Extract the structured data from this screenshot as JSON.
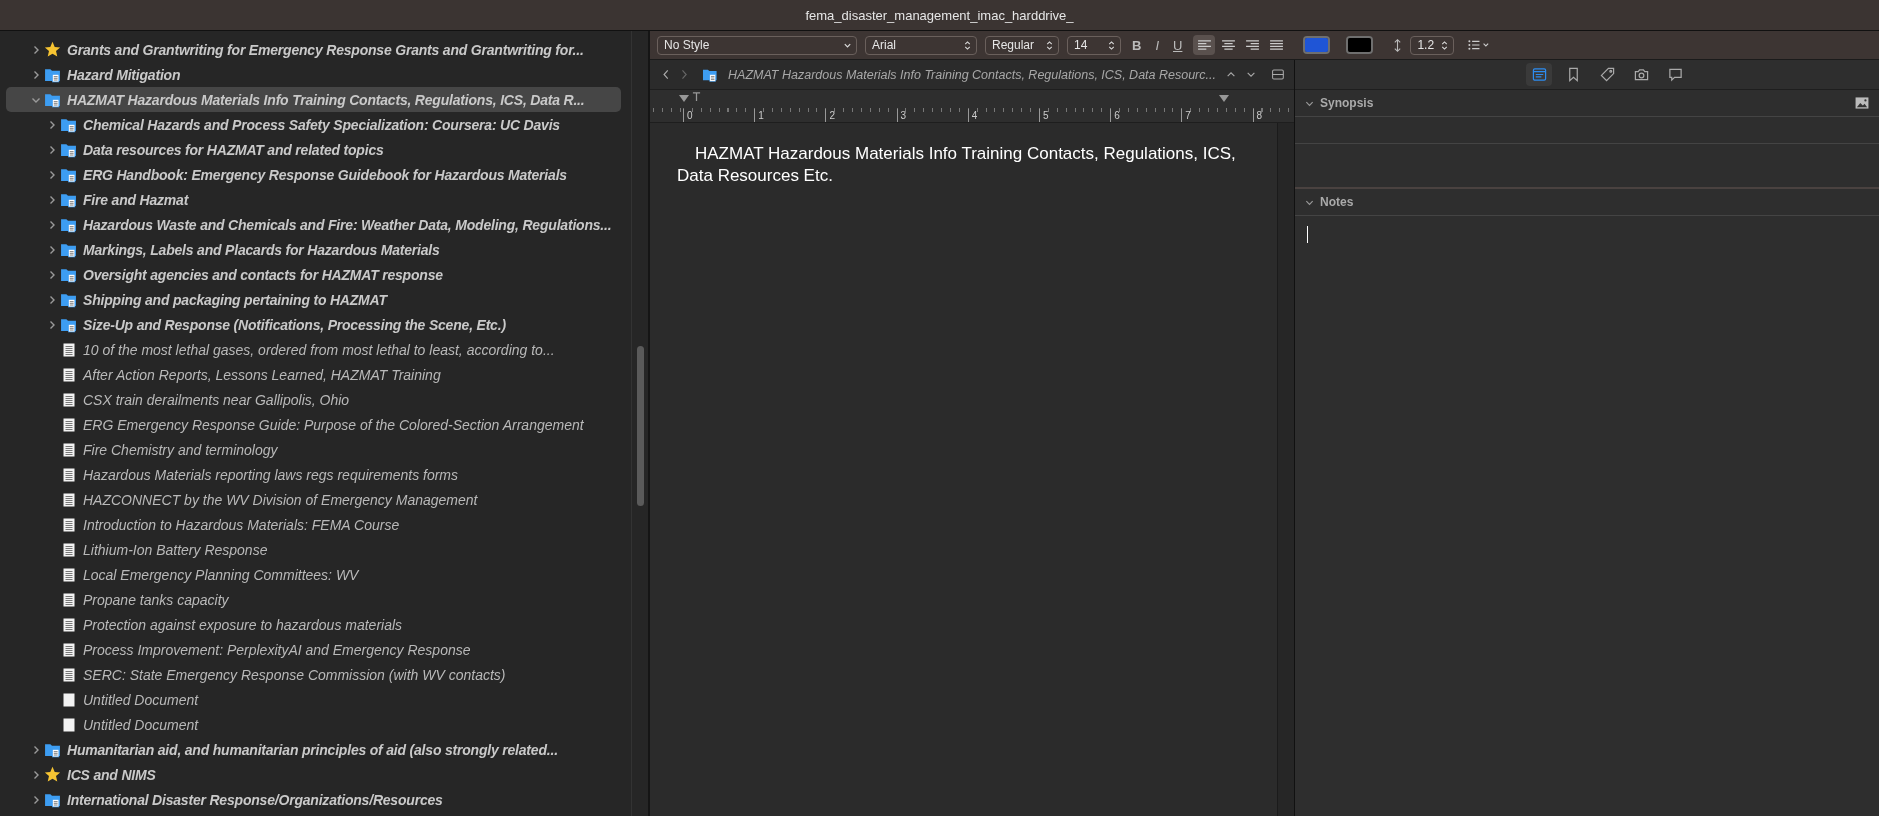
{
  "window": {
    "title": "fema_disaster_management_imac_harddrive_"
  },
  "binder": [
    {
      "kind": "star",
      "label": "Grants and Grantwriting for Emergency Response Grants and Grantwriting for...",
      "expanded": false,
      "selected": false
    },
    {
      "kind": "folder",
      "label": "Hazard Mitigation",
      "expanded": false,
      "selected": false
    },
    {
      "kind": "folder",
      "label": "HAZMAT Hazardous Materials Info Training Contacts, Regulations, ICS, Data R...",
      "expanded": true,
      "selected": true,
      "children": [
        {
          "kind": "folder",
          "label": "Chemical Hazards and Process Safety Specialization: Coursera: UC Davis",
          "expanded": false,
          "selected": false
        },
        {
          "kind": "folder",
          "label": "Data resources for HAZMAT and related topics",
          "expanded": false,
          "selected": false
        },
        {
          "kind": "folder",
          "label": "ERG Handbook: Emergency Response Guidebook for Hazardous Materials",
          "expanded": false,
          "selected": false
        },
        {
          "kind": "folder",
          "label": "Fire and Hazmat",
          "expanded": false,
          "selected": false
        },
        {
          "kind": "folder",
          "label": "Hazardous Waste and Chemicals and Fire: Weather Data, Modeling, Regulations...",
          "expanded": false,
          "selected": false
        },
        {
          "kind": "folder",
          "label": "Markings, Labels and Placards for Hazardous Materials",
          "expanded": false,
          "selected": false
        },
        {
          "kind": "folder",
          "label": "Oversight agencies and contacts for HAZMAT response",
          "expanded": false,
          "selected": false
        },
        {
          "kind": "folder",
          "label": "Shipping and packaging pertaining to HAZMAT",
          "expanded": false,
          "selected": false
        },
        {
          "kind": "folder",
          "label": "Size-Up and Response (Notifications, Processing the Scene, Etc.)",
          "expanded": false,
          "selected": false
        },
        {
          "kind": "doc",
          "label": "10 of the most lethal gases, ordered from most lethal to least, according to...",
          "selected": false
        },
        {
          "kind": "doc",
          "label": "After Action Reports, Lessons Learned, HAZMAT Training",
          "selected": false
        },
        {
          "kind": "doc",
          "label": "CSX train derailments near Gallipolis, Ohio",
          "selected": false
        },
        {
          "kind": "doc",
          "label": "ERG Emergency Response Guide: Purpose of the Colored-Section Arrangement",
          "selected": false
        },
        {
          "kind": "doc",
          "label": "Fire Chemistry and terminology",
          "selected": false
        },
        {
          "kind": "doc",
          "label": "Hazardous Materials reporting laws regs requirements forms",
          "selected": false
        },
        {
          "kind": "doc",
          "label": "HAZCONNECT by the WV Division of Emergency Management",
          "selected": false
        },
        {
          "kind": "doc",
          "label": "Introduction to Hazardous Materials: FEMA Course",
          "selected": false
        },
        {
          "kind": "doc",
          "label": "Lithium-Ion Battery Response",
          "selected": false
        },
        {
          "kind": "doc",
          "label": "Local Emergency Planning Committees: WV",
          "selected": false
        },
        {
          "kind": "doc",
          "label": "Propane tanks capacity",
          "selected": false
        },
        {
          "kind": "doc",
          "label": "Protection against exposure to hazardous materials",
          "selected": false
        },
        {
          "kind": "doc",
          "label": "Process Improvement: PerplexityAI and Emergency Response",
          "selected": false
        },
        {
          "kind": "doc",
          "label": "SERC: State Emergency Response Commission (with WV contacts)",
          "selected": false
        },
        {
          "kind": "blank",
          "label": "Untitled Document",
          "selected": false
        },
        {
          "kind": "blank",
          "label": "Untitled Document",
          "selected": false
        }
      ]
    },
    {
      "kind": "folder",
      "label": "Humanitarian aid, and humanitarian principles of aid (also strongly related...",
      "expanded": false,
      "selected": false
    },
    {
      "kind": "star",
      "label": "ICS and NIMS",
      "expanded": false,
      "selected": false
    },
    {
      "kind": "folder",
      "label": "International Disaster Response/Organizations/Resources",
      "expanded": false,
      "selected": false
    }
  ],
  "format_bar": {
    "style": "No Style",
    "font": "Arial",
    "weight": "Regular",
    "size": "14",
    "styles": [
      {
        "kind": "bold",
        "label": "B"
      },
      {
        "kind": "italic",
        "label": "I"
      },
      {
        "kind": "underline",
        "label": "U"
      }
    ],
    "alignments": [
      {
        "kind": "left",
        "selected": true
      },
      {
        "kind": "center",
        "selected": false
      },
      {
        "kind": "right",
        "selected": false
      },
      {
        "kind": "justify",
        "selected": false
      }
    ],
    "swatches": [
      {
        "color": "#1f55d6"
      },
      {
        "color": "#000000"
      }
    ],
    "line_spacing": "1.2"
  },
  "editor": {
    "header_title": "HAZMAT Hazardous Materials Info Training Contacts, Regulations, ICS, Data Resourc...",
    "ruler": [
      "0",
      "1",
      "2",
      "3",
      "4",
      "5",
      "6",
      "7",
      "8"
    ],
    "text": "HAZMAT Hazardous Materials Info Training Contacts, Regulations, ICS, Data Resources Etc."
  },
  "inspector": {
    "tabs": [
      {
        "kind": "notes",
        "selected": true
      },
      {
        "kind": "bookmarks",
        "selected": false
      },
      {
        "kind": "tags",
        "selected": false
      },
      {
        "kind": "snapshots",
        "selected": false
      },
      {
        "kind": "comments",
        "selected": false
      }
    ],
    "sections": [
      {
        "kind": "synopsis",
        "title": "Synopsis",
        "expanded": true
      },
      {
        "kind": "notes",
        "title": "Notes",
        "expanded": true
      }
    ]
  }
}
